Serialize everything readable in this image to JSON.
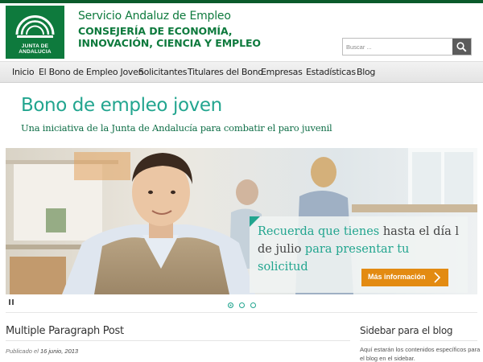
{
  "header": {
    "logo_text": "JUNTA DE ANDALUCIA",
    "org_name": "Servicio Andaluz de Empleo",
    "department": "CONSEJERÍA DE ECONOMÍA, INNOVACIÓN, CIENCIA Y EMPLEO"
  },
  "search": {
    "placeholder": "Buscar ...",
    "button_icon": "search-icon"
  },
  "nav": {
    "items": [
      {
        "label": "Inicio"
      },
      {
        "label": "El Bono de Empleo Joven"
      },
      {
        "label": "Solicitantes"
      },
      {
        "label": "Titulares del Bono"
      },
      {
        "label": "Empresas"
      },
      {
        "label": "Estadísticas"
      },
      {
        "label": "Blog"
      }
    ]
  },
  "hero": {
    "title": "Bono de empleo joven",
    "subtitle": "Una iniciativa de la Junta de Andalucía para combatir el paro juvenil"
  },
  "slider": {
    "caption_part1": "Recuerda que tienes ",
    "caption_part2": "hasta el día l de julio ",
    "caption_part3": "para presentar tu solicitud",
    "cta_label": "Más información",
    "pause_icon": "pause-icon",
    "slide_count": 3,
    "active_slide": 1
  },
  "post": {
    "title": "Multiple Paragraph Post",
    "meta_prefix": "Publicado el ",
    "date": "16 junio, 2013"
  },
  "sidebar": {
    "title": "Sidebar para el blog",
    "text": "Aquí estarán los contenidos específicos para el blog en el sidebar."
  },
  "colors": {
    "brand_green": "#0e7a3d",
    "accent_teal": "#22a58f",
    "cta_orange": "#e38b12"
  }
}
